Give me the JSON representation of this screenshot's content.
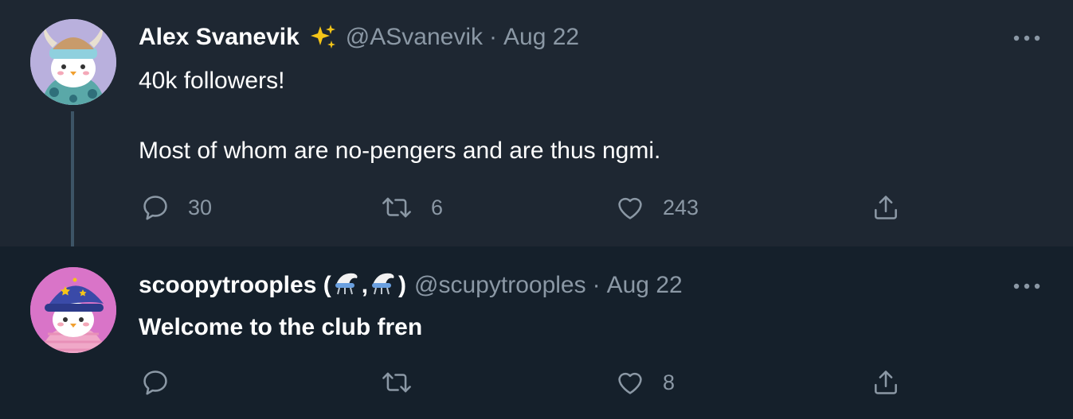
{
  "tweets": [
    {
      "name": "Alex Svanevik",
      "name_emoji": "✨",
      "handle": "@ASvanevik",
      "separator": "·",
      "date": "Aug 22",
      "text_lines": [
        "40k followers!",
        "Most of whom are no-pengers and are thus ngmi."
      ],
      "counts": {
        "reply": "30",
        "retweet": "6",
        "like": "243"
      }
    },
    {
      "name": "scoopytrooples",
      "name_suffix_open": " (",
      "name_suffix_comma": ",",
      "name_suffix_close": ")",
      "handle": "@scupytrooples",
      "separator": "·",
      "date": "Aug 22",
      "text_lines": [
        "Welcome to the club fren"
      ],
      "counts": {
        "reply": "",
        "retweet": "",
        "like": "8"
      }
    }
  ],
  "icons": {
    "more": "more-horizontal-icon",
    "reply": "reply-icon",
    "retweet": "retweet-icon",
    "like": "heart-icon",
    "share": "share-icon",
    "sparkles": "sparkles-icon",
    "hat": "penguin-hat-icon"
  },
  "colors": {
    "background": "#15202b",
    "highlight": "#1e2732",
    "secondary_text": "#8b98a5",
    "thread_line": "#3d5466",
    "sparkles": "#f5c518"
  }
}
